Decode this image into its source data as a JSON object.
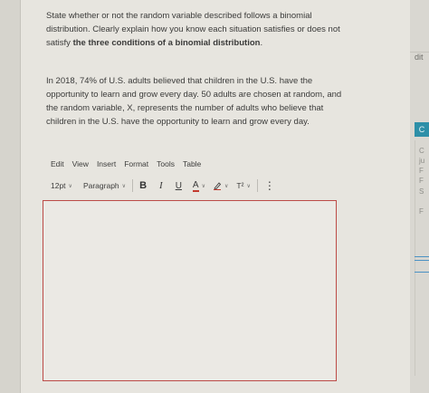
{
  "question": {
    "intro_part1": "State whether or not the random variable described follows a binomial distribution. Clearly explain how you know each situation satisfies or does not satisfy ",
    "intro_bold": "the three conditions of a binomial distribution",
    "intro_end": ".",
    "scenario": "In 2018, 74% of U.S. adults believed that children in the U.S. have the opportunity to learn and grow every day. 50 adults are chosen at random, and the random variable, X, represents the number of adults who believe that children in the U.S. have the opportunity to learn and grow every day."
  },
  "editor": {
    "menu": [
      "Edit",
      "View",
      "Insert",
      "Format",
      "Tools",
      "Table"
    ],
    "font_size": "12pt",
    "block_format": "Paragraph",
    "bold_label": "B",
    "italic_label": "I",
    "underline_label": "U",
    "text_color_label": "A",
    "superscript_label": "T²",
    "more_label": "⋮",
    "content": ""
  },
  "side": {
    "edit_label": "dit",
    "badge_label": "C",
    "letters": [
      "C",
      "ju",
      "F",
      "F",
      "S",
      "F"
    ]
  },
  "colors": {
    "panel_bg": "#e7e5df",
    "editor_border": "#bc4b47",
    "text_color_underline": "#c23a2e",
    "side_badge": "#2d8fa8"
  }
}
